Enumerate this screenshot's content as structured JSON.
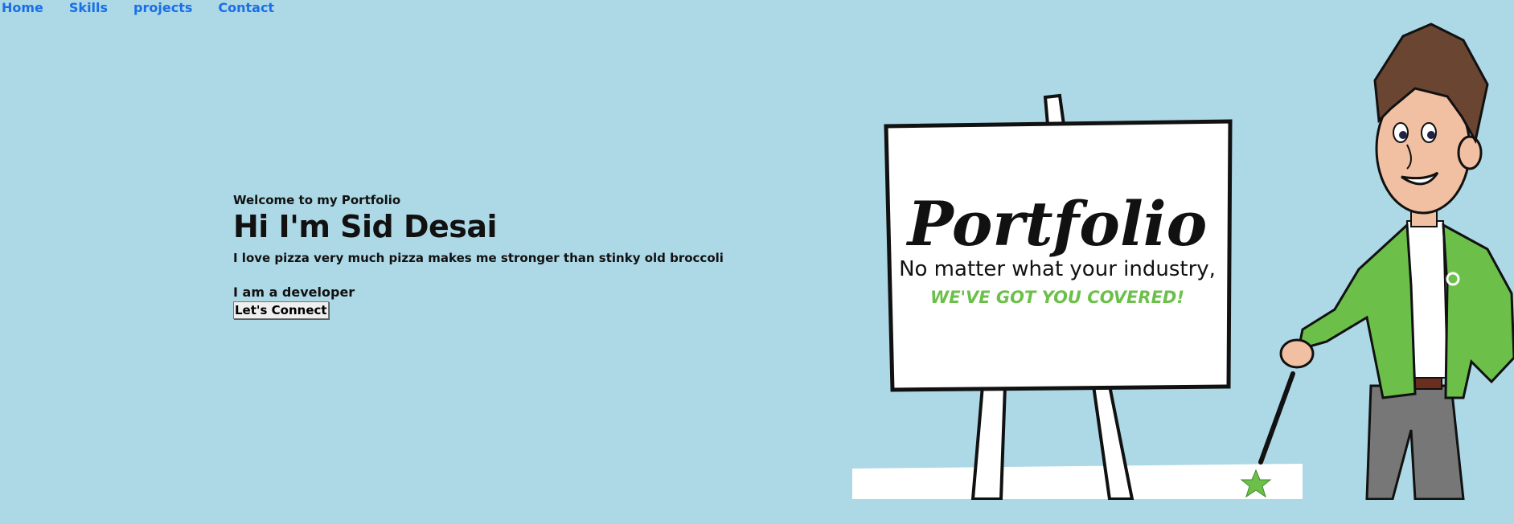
{
  "nav": {
    "items": [
      {
        "label": "Home"
      },
      {
        "label": "Skills"
      },
      {
        "label": "projects"
      },
      {
        "label": "Contact"
      }
    ]
  },
  "hero": {
    "welcome": "Welcome to my Portfolio",
    "title": "Hi I'm Sid Desai",
    "tagline": "I love pizza very much pizza makes me stronger than stinky old broccoli",
    "role": "I am a developer",
    "button_label": "Let's Connect"
  },
  "illustration": {
    "sign_title": "Portfolio",
    "sign_line1": "No matter what your industry,",
    "sign_line2": "WE'VE GOT YOU COVERED!"
  },
  "colors": {
    "background": "#add8e6",
    "nav_link": "#1a6fe6",
    "accent_green": "#6cc04a"
  }
}
